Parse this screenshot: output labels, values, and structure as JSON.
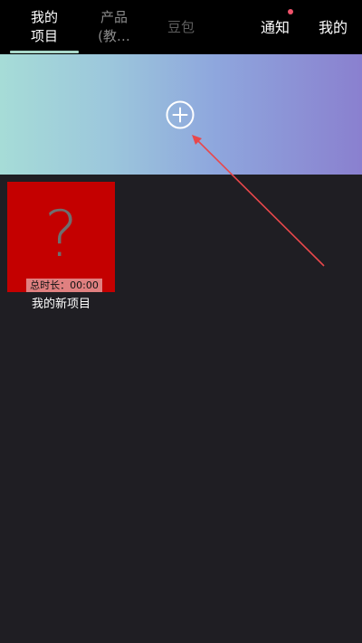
{
  "tabs": {
    "my_projects": [
      "我的",
      "项目"
    ],
    "products": [
      "产品",
      "(教…"
    ],
    "doubao": "豆包",
    "notifications": "通知",
    "mine": "我的"
  },
  "banner": {
    "add_icon": "plus-circle-icon"
  },
  "projects": [
    {
      "name": "我的新项目",
      "duration": "总时长：00:00",
      "thumbnail_icon": "question-mark-icon"
    }
  ],
  "colors": {
    "topbar": "#000000",
    "background": "#1f1e23",
    "active_underline": "#a9d8c9",
    "notify_dot": "#f0536b",
    "card_bg": "#c40000",
    "annotation_arrow": "#e8474b"
  }
}
